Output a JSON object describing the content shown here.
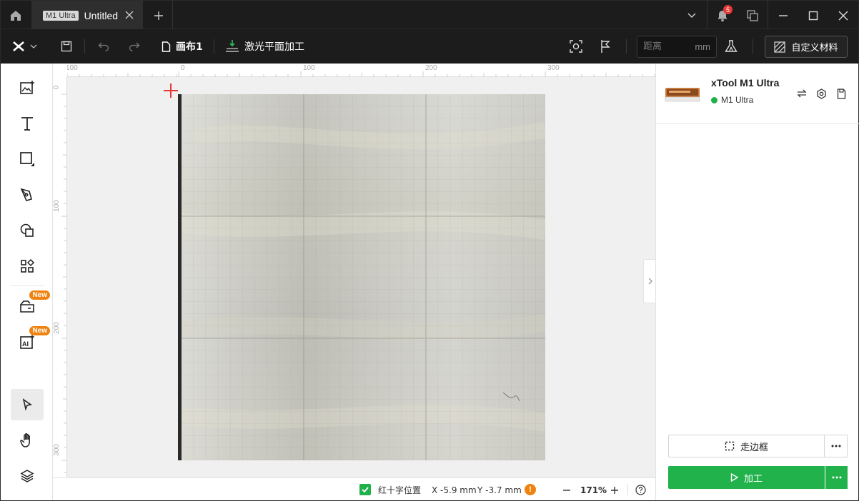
{
  "titlebar": {
    "tab_badge": "M1 Ultra",
    "tab_title": "Untitled",
    "notification_count": "5"
  },
  "toolbar": {
    "canvas_name": "画布1",
    "mode_label": "激光平面加工",
    "distance_placeholder": "距离",
    "distance_unit": "mm",
    "material_label": "自定义材料"
  },
  "sidebar": {
    "new_badge_1": "New",
    "new_badge_2": "New"
  },
  "ruler": {
    "top_ticks": [
      "100",
      "0",
      "100",
      "200",
      "300"
    ],
    "left_ticks": [
      "0",
      "100",
      "200",
      "300"
    ]
  },
  "device": {
    "name": "xTool M1 Ultra",
    "status": "M1 Ultra",
    "status_color": "#20b14a"
  },
  "actions": {
    "frame_label": "走边框",
    "process_label": "加工",
    "accent": "#22b24c"
  },
  "statusbar": {
    "crosshair_label": "红十字位置",
    "x_coord": "X -5.9 mm",
    "y_coord": "Y -3.7 mm",
    "warning": "!",
    "zoom": "171%"
  }
}
